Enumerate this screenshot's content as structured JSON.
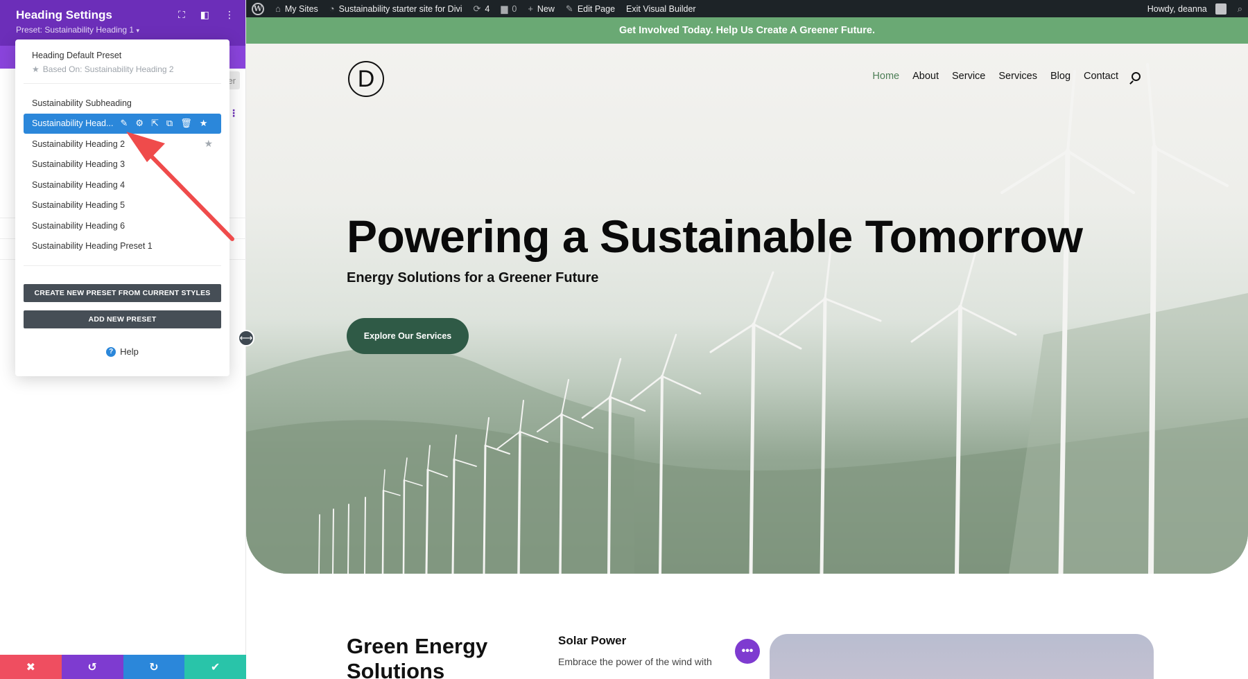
{
  "admin_bar": {
    "my_sites": "My Sites",
    "site_name": "Sustainability starter site for Divi",
    "updates_count": "4",
    "comments_count": "0",
    "new_label": "New",
    "edit_page": "Edit Page",
    "exit_builder": "Exit Visual Builder",
    "howdy": "Howdy, deanna"
  },
  "panel": {
    "title": "Heading Settings",
    "preset_label": "Preset: Sustainability Heading 1",
    "ghost_tab_text": "er",
    "footer": {
      "cancel": "✖",
      "undo": "↺",
      "redo": "↻",
      "save": "✔"
    }
  },
  "preset_menu": {
    "default_title": "Heading Default Preset",
    "based_on": "Based On: Sustainability Heading 2",
    "items": [
      {
        "label": "Sustainability Subheading"
      },
      {
        "label": "Sustainability Head..."
      },
      {
        "label": "Sustainability Heading 2"
      },
      {
        "label": "Sustainability Heading 3"
      },
      {
        "label": "Sustainability Heading 4"
      },
      {
        "label": "Sustainability Heading 5"
      },
      {
        "label": "Sustainability Heading 6"
      },
      {
        "label": "Sustainability Heading Preset 1"
      }
    ],
    "create_button": "CREATE NEW PRESET FROM CURRENT STYLES",
    "add_button": "ADD NEW PRESET",
    "help": "Help"
  },
  "site": {
    "top_banner": "Get Involved Today. Help Us Create A Greener Future.",
    "logo_letter": "D",
    "menu": [
      "Home",
      "About",
      "Service",
      "Services",
      "Blog",
      "Contact"
    ],
    "hero_title": "Powering a Sustainable Tomorrow",
    "hero_subtitle": "Energy Solutions for a Greener Future",
    "hero_button": "Explore Our Services",
    "section_title": "Green Energy Solutions",
    "card_title": "Solar Power",
    "card_text": "Embrace the power of the wind with"
  },
  "colors": {
    "builder_purple": "#6c2eb9",
    "active_blue": "#2b87da",
    "banner_green": "#6aa974",
    "button_green": "#2f5a46",
    "annotation_red": "#ef4b4b"
  }
}
